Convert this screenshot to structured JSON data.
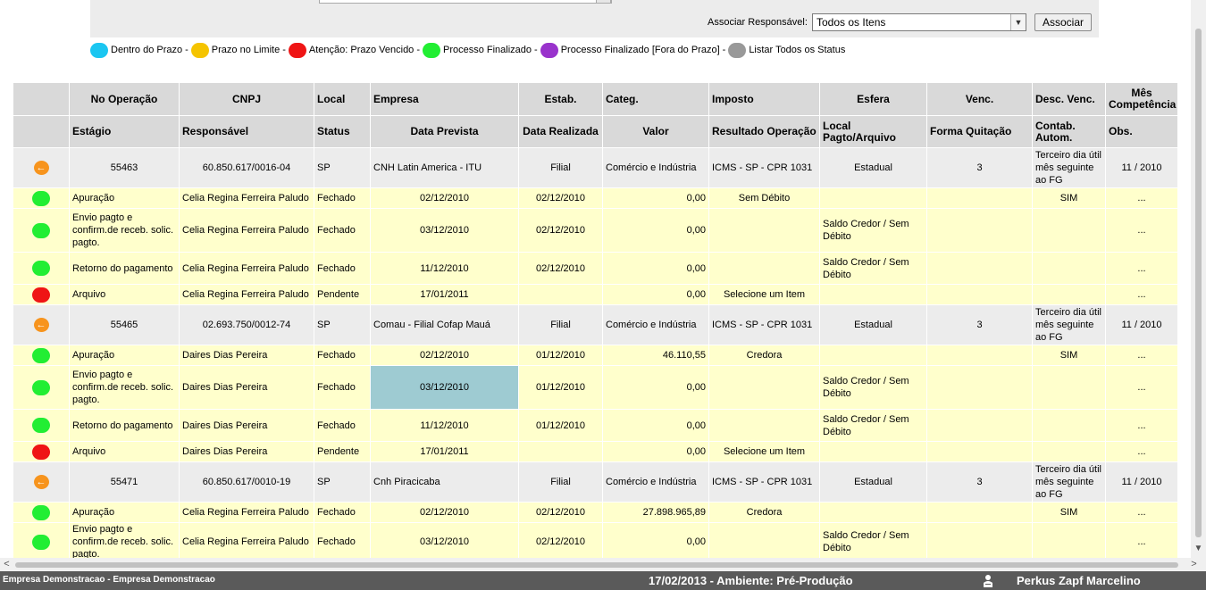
{
  "toolbar": {
    "assoc_label": "Associar Responsável:",
    "assoc_selected": "Todos os Itens",
    "assoc_button": "Associar"
  },
  "legend": [
    {
      "label": "Dentro do Prazo",
      "color": "#1bc6f1",
      "sep": " - "
    },
    {
      "label": "Prazo no Limite",
      "color": "#f5c400",
      "sep": " - "
    },
    {
      "label": "Atenção: Prazo Vencido",
      "color": "#ef1515",
      "sep": " - "
    },
    {
      "label": "Processo Finalizado",
      "color": "#22ee33",
      "sep": " - "
    },
    {
      "label": "Processo Finalizado [Fora do Prazo]",
      "color": "#9933cc",
      "sep": " - "
    },
    {
      "label": "Listar Todos os Status",
      "color": "#999999",
      "sep": ""
    }
  ],
  "header1": [
    "No Operação",
    "CNPJ",
    "Local",
    "Empresa",
    "Estab.",
    "Categ.",
    "Imposto",
    "Esfera",
    "Venc.",
    "Desc. Venc.",
    "Mês Competência"
  ],
  "header2": [
    "Estágio",
    "Responsável",
    "Status",
    "Data Prevista",
    "Data Realizada",
    "Valor",
    "Resultado Operação",
    "Local Pagto/Arquivo",
    "Forma Quitação",
    "Contab. Autom.",
    "Obs."
  ],
  "colors": {
    "green": "#22ee33",
    "red": "#ef1515",
    "orange": "#f7941d"
  },
  "operations": [
    {
      "op": {
        "no": "55463",
        "cnpj": "60.850.617/0016-04",
        "local": "SP",
        "empresa": "CNH Latin America - ITU",
        "estab": "Filial",
        "categ": "Comércio e Indústria",
        "imposto": "ICMS - SP - CPR 1031",
        "esfera": "Estadual",
        "venc": "3",
        "desc_venc": "Terceiro dia útil mês seguinte ao FG",
        "mes": "11 / 2010"
      },
      "stages": [
        {
          "status_color": "green",
          "estagio": "Apuração",
          "resp": "Celia Regina Ferreira Paludo",
          "status": "Fechado",
          "prevista": "02/12/2010",
          "realizada": "02/12/2010",
          "valor": "0,00",
          "resultado": "Sem Débito",
          "local_pagto": "",
          "forma": "",
          "contab": "SIM",
          "obs": "..."
        },
        {
          "status_color": "green",
          "estagio": "Envio pagto e confirm.de receb. solic. pagto.",
          "resp": "Celia Regina Ferreira Paludo",
          "status": "Fechado",
          "prevista": "03/12/2010",
          "realizada": "02/12/2010",
          "valor": "0,00",
          "resultado": "",
          "local_pagto": "Saldo Credor / Sem Débito",
          "forma": "",
          "contab": "",
          "obs": "..."
        },
        {
          "status_color": "green",
          "estagio": "Retorno do pagamento",
          "resp": "Celia Regina Ferreira Paludo",
          "status": "Fechado",
          "prevista": "11/12/2010",
          "realizada": "02/12/2010",
          "valor": "0,00",
          "resultado": "",
          "local_pagto": "Saldo Credor / Sem Débito",
          "forma": "",
          "contab": "",
          "obs": "..."
        },
        {
          "status_color": "red",
          "estagio": "Arquivo",
          "resp": "Celia Regina Ferreira Paludo",
          "status": "Pendente",
          "prevista": "17/01/2011",
          "realizada": "",
          "valor": "0,00",
          "resultado": "Selecione um Item",
          "local_pagto": "",
          "forma": "",
          "contab": "",
          "obs": "..."
        }
      ]
    },
    {
      "op": {
        "no": "55465",
        "cnpj": "02.693.750/0012-74",
        "local": "SP",
        "empresa": "Comau - Filial Cofap Mauá",
        "estab": "Filial",
        "categ": "Comércio e Indústria",
        "imposto": "ICMS - SP - CPR 1031",
        "esfera": "Estadual",
        "venc": "3",
        "desc_venc": "Terceiro dia útil mês seguinte ao FG",
        "mes": "11 / 2010"
      },
      "stages": [
        {
          "status_color": "green",
          "estagio": "Apuração",
          "resp": "Daires Dias Pereira",
          "status": "Fechado",
          "prevista": "02/12/2010",
          "realizada": "01/12/2010",
          "valor": "46.110,55",
          "resultado": "Credora",
          "local_pagto": "",
          "forma": "",
          "contab": "SIM",
          "obs": "..."
        },
        {
          "status_color": "green",
          "estagio": "Envio pagto e confirm.de receb. solic. pagto.",
          "resp": "Daires Dias Pereira",
          "status": "Fechado",
          "prevista": "03/12/2010",
          "realizada": "01/12/2010",
          "valor": "0,00",
          "resultado": "",
          "local_pagto": "Saldo Credor / Sem Débito",
          "forma": "",
          "contab": "",
          "obs": "...",
          "highlight": true
        },
        {
          "status_color": "green",
          "estagio": "Retorno do pagamento",
          "resp": "Daires Dias Pereira",
          "status": "Fechado",
          "prevista": "11/12/2010",
          "realizada": "01/12/2010",
          "valor": "0,00",
          "resultado": "",
          "local_pagto": "Saldo Credor / Sem Débito",
          "forma": "",
          "contab": "",
          "obs": "..."
        },
        {
          "status_color": "red",
          "estagio": "Arquivo",
          "resp": "Daires Dias Pereira",
          "status": "Pendente",
          "prevista": "17/01/2011",
          "realizada": "",
          "valor": "0,00",
          "resultado": "Selecione um Item",
          "local_pagto": "",
          "forma": "",
          "contab": "",
          "obs": "..."
        }
      ]
    },
    {
      "op": {
        "no": "55471",
        "cnpj": "60.850.617/0010-19",
        "local": "SP",
        "empresa": "Cnh Piracicaba",
        "estab": "Filial",
        "categ": "Comércio e Indústria",
        "imposto": "ICMS - SP - CPR 1031",
        "esfera": "Estadual",
        "venc": "3",
        "desc_venc": "Terceiro dia útil mês seguinte ao FG",
        "mes": "11 / 2010"
      },
      "stages": [
        {
          "status_color": "green",
          "estagio": "Apuração",
          "resp": "Celia Regina Ferreira Paludo",
          "status": "Fechado",
          "prevista": "02/12/2010",
          "realizada": "02/12/2010",
          "valor": "27.898.965,89",
          "resultado": "Credora",
          "local_pagto": "",
          "forma": "",
          "contab": "SIM",
          "obs": "..."
        },
        {
          "status_color": "green",
          "estagio": "Envio pagto e confirm.de receb. solic. pagto.",
          "resp": "Celia Regina Ferreira Paludo",
          "status": "Fechado",
          "prevista": "03/12/2010",
          "realizada": "02/12/2010",
          "valor": "0,00",
          "resultado": "",
          "local_pagto": "Saldo Credor / Sem Débito",
          "forma": "",
          "contab": "",
          "obs": "..."
        }
      ]
    }
  ],
  "footer": {
    "company": "Empresa Demonstracao - Empresa Demonstracao",
    "env": "17/02/2013 - Ambiente: Pré-Produção",
    "user": "Perkus Zapf Marcelino"
  }
}
